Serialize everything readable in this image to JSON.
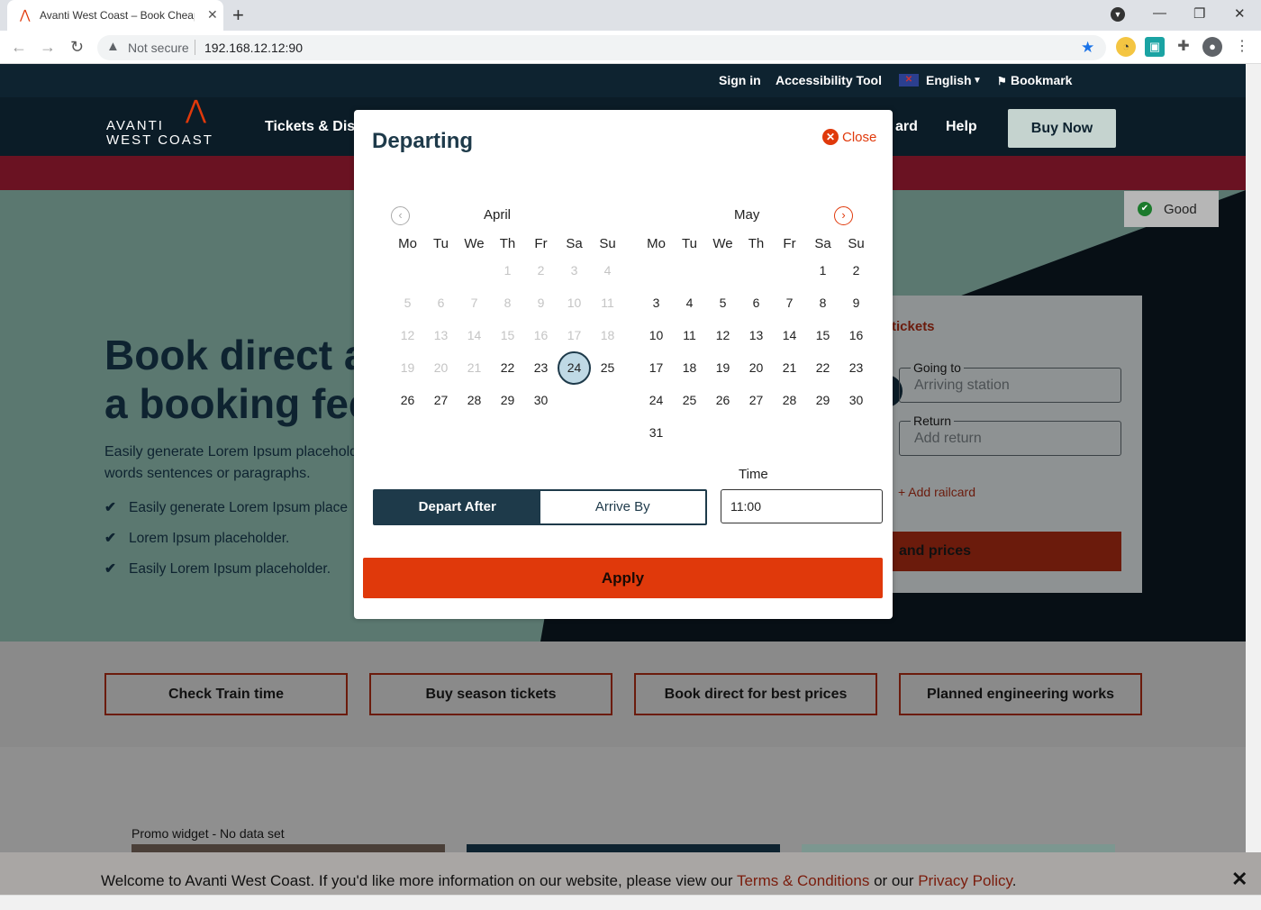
{
  "browser": {
    "tab_title": "Avanti West Coast – Book Cheap",
    "tab_close": "✕",
    "new_tab": "+",
    "security": "Not secure",
    "url": "192.168.12.12:90"
  },
  "topbar": {
    "sign_in": "Sign in",
    "accessibility": "Accessibility Tool",
    "language": "English",
    "bookmark": "Bookmark"
  },
  "nav": {
    "logo_line1": "AVANTI",
    "logo_line2": "WEST COAST",
    "tickets": "Tickets & Disc",
    "card": "ard",
    "help": "Help",
    "buy_now": "Buy Now"
  },
  "hero": {
    "title_line1": "Book direct a",
    "title_line2": "a booking fee",
    "para_line1": "Easily generate Lorem Ipsum placehold",
    "para_line2": "words sentences or paragraphs.",
    "bullets": [
      "Easily generate Lorem Ipsum place",
      "Lorem Ipsum placeholder.",
      "Easily Lorem Ipsum placeholder."
    ],
    "check": "✔"
  },
  "status": {
    "label": "Good",
    "icon": "✔"
  },
  "booking": {
    "title": "tickets",
    "going_to_label": "Going to",
    "going_to_placeholder": "Arriving station",
    "return_label": "Return",
    "return_placeholder": "Add return",
    "railcard": "+ Add railcard",
    "find_button": "and prices"
  },
  "cards": [
    "Check Train time",
    "Buy season tickets",
    "Book direct for best prices",
    "Planned engineering works"
  ],
  "promo": "Promo widget - No data set",
  "cookie": {
    "text_before": "Welcome to Avanti West Coast. If you'd like more information on our website, please view our ",
    "terms": "Terms & Conditions",
    "middle": " or our ",
    "privacy": "Privacy Policy",
    "after": ".",
    "close": "✕"
  },
  "modal": {
    "title": "Departing",
    "close": "Close",
    "weekdays": [
      "Mo",
      "Tu",
      "We",
      "Th",
      "Fr",
      "Sa",
      "Su"
    ],
    "months": [
      {
        "name": "April",
        "offset": 3,
        "days": 30,
        "enabled_from": 22,
        "selected": 24
      },
      {
        "name": "May",
        "offset": 5,
        "days": 31,
        "enabled_from": 1,
        "selected": null
      }
    ],
    "depart_after": "Depart After",
    "arrive_by": "Arrive By",
    "time_label": "Time",
    "time_value": "11:00",
    "apply": "Apply"
  },
  "colors": {
    "accent": "#e0390b",
    "navy": "#1e3a4a",
    "selected_day": "#bfd9e5"
  }
}
